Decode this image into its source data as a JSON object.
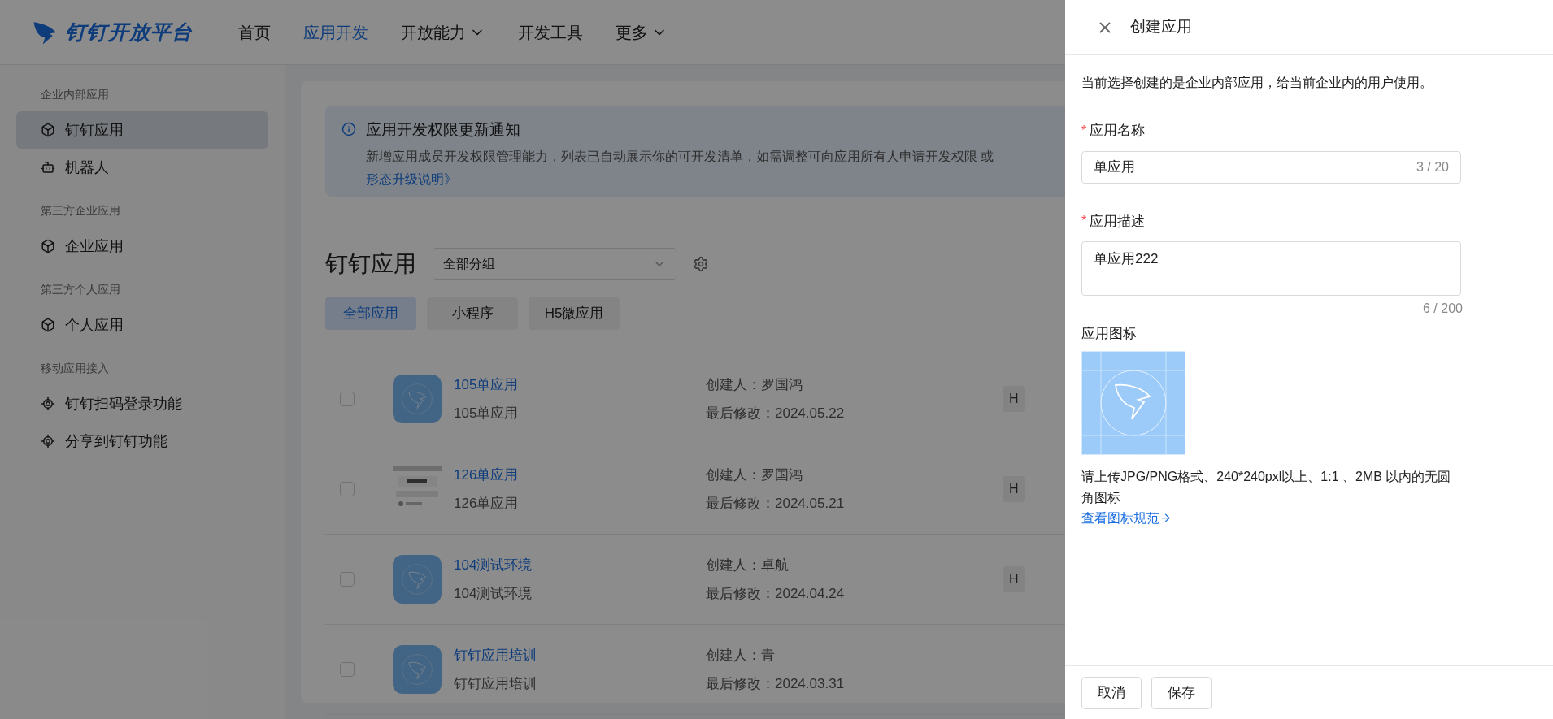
{
  "top_nav": {
    "logo_text": "钉钉开放平台",
    "items": [
      {
        "label": "首页",
        "selected": false,
        "dropdown": false
      },
      {
        "label": "应用开发",
        "selected": true,
        "dropdown": false
      },
      {
        "label": "开放能力",
        "selected": false,
        "dropdown": true
      },
      {
        "label": "开发工具",
        "selected": false,
        "dropdown": false
      },
      {
        "label": "更多",
        "selected": false,
        "dropdown": true
      }
    ]
  },
  "sidebar": {
    "sections": [
      {
        "title": "企业内部应用",
        "items": [
          {
            "label": "钉钉应用",
            "kind": "cube",
            "selected": true
          },
          {
            "label": "机器人",
            "kind": "robot",
            "selected": false
          }
        ]
      },
      {
        "title": "第三方企业应用",
        "items": [
          {
            "label": "企业应用",
            "kind": "cube",
            "selected": false
          }
        ]
      },
      {
        "title": "第三方个人应用",
        "items": [
          {
            "label": "个人应用",
            "kind": "cube",
            "selected": false
          }
        ]
      },
      {
        "title": "移动应用接入",
        "items": [
          {
            "label": "钉钉扫码登录功能",
            "kind": "target",
            "selected": false
          },
          {
            "label": "分享到钉钉功能",
            "kind": "target",
            "selected": false
          }
        ]
      }
    ]
  },
  "notice": {
    "title": "应用开发权限更新通知",
    "body": "新增应用成员开发权限管理能力，列表已自动展示你的可开发清单，如需调整可向应用所有人申请开发权限 或",
    "link": "形态升级说明》"
  },
  "apps_header": {
    "title": "钉钉应用",
    "group_select": "全部分组"
  },
  "filter_tabs": [
    {
      "label": "全部应用",
      "selected": true
    },
    {
      "label": "小程序",
      "selected": false
    },
    {
      "label": "H5微应用",
      "selected": false
    }
  ],
  "apps": [
    {
      "name": "105单应用",
      "description": "105单应用",
      "creator": "创建人：罗国鸿",
      "modified": "最后修改：2024.05.22",
      "tag": "H",
      "kind": "logo",
      "checked": false
    },
    {
      "name": "126单应用",
      "description": "126单应用",
      "creator": "创建人：罗国鸿",
      "modified": "最后修改：2024.05.21",
      "tag": "H",
      "kind": "picture",
      "checked": false
    },
    {
      "name": "104测试环境",
      "description": "104测试环境",
      "creator": "创建人：卓航",
      "modified": "最后修改：2024.04.24",
      "tag": "H",
      "kind": "logo",
      "checked": false
    },
    {
      "name": "钉钉应用培训",
      "description": "钉钉应用培训",
      "creator": "创建人：青",
      "modified": "最后修改：2024.03.31",
      "kind": "logo",
      "checked": false
    }
  ],
  "drawer": {
    "title": "创建应用",
    "intro": "当前选择创建的是企业内部应用，给当前企业内的用户使用。",
    "name_field": {
      "label": "应用名称",
      "required_mark": "*",
      "value": "单应用",
      "counter": "3 / 20"
    },
    "desc_field": {
      "label": "应用描述",
      "required_mark": "*",
      "value": "单应用222",
      "counter": "6 / 200"
    },
    "icon_label": "应用图标",
    "icon_hint": "请上传JPG/PNG格式、240*240pxl以上、1:1 、2MB 以内的无圆角图标",
    "icon_link": "查看图标规范",
    "buttons": [
      "取消",
      "保存"
    ]
  }
}
